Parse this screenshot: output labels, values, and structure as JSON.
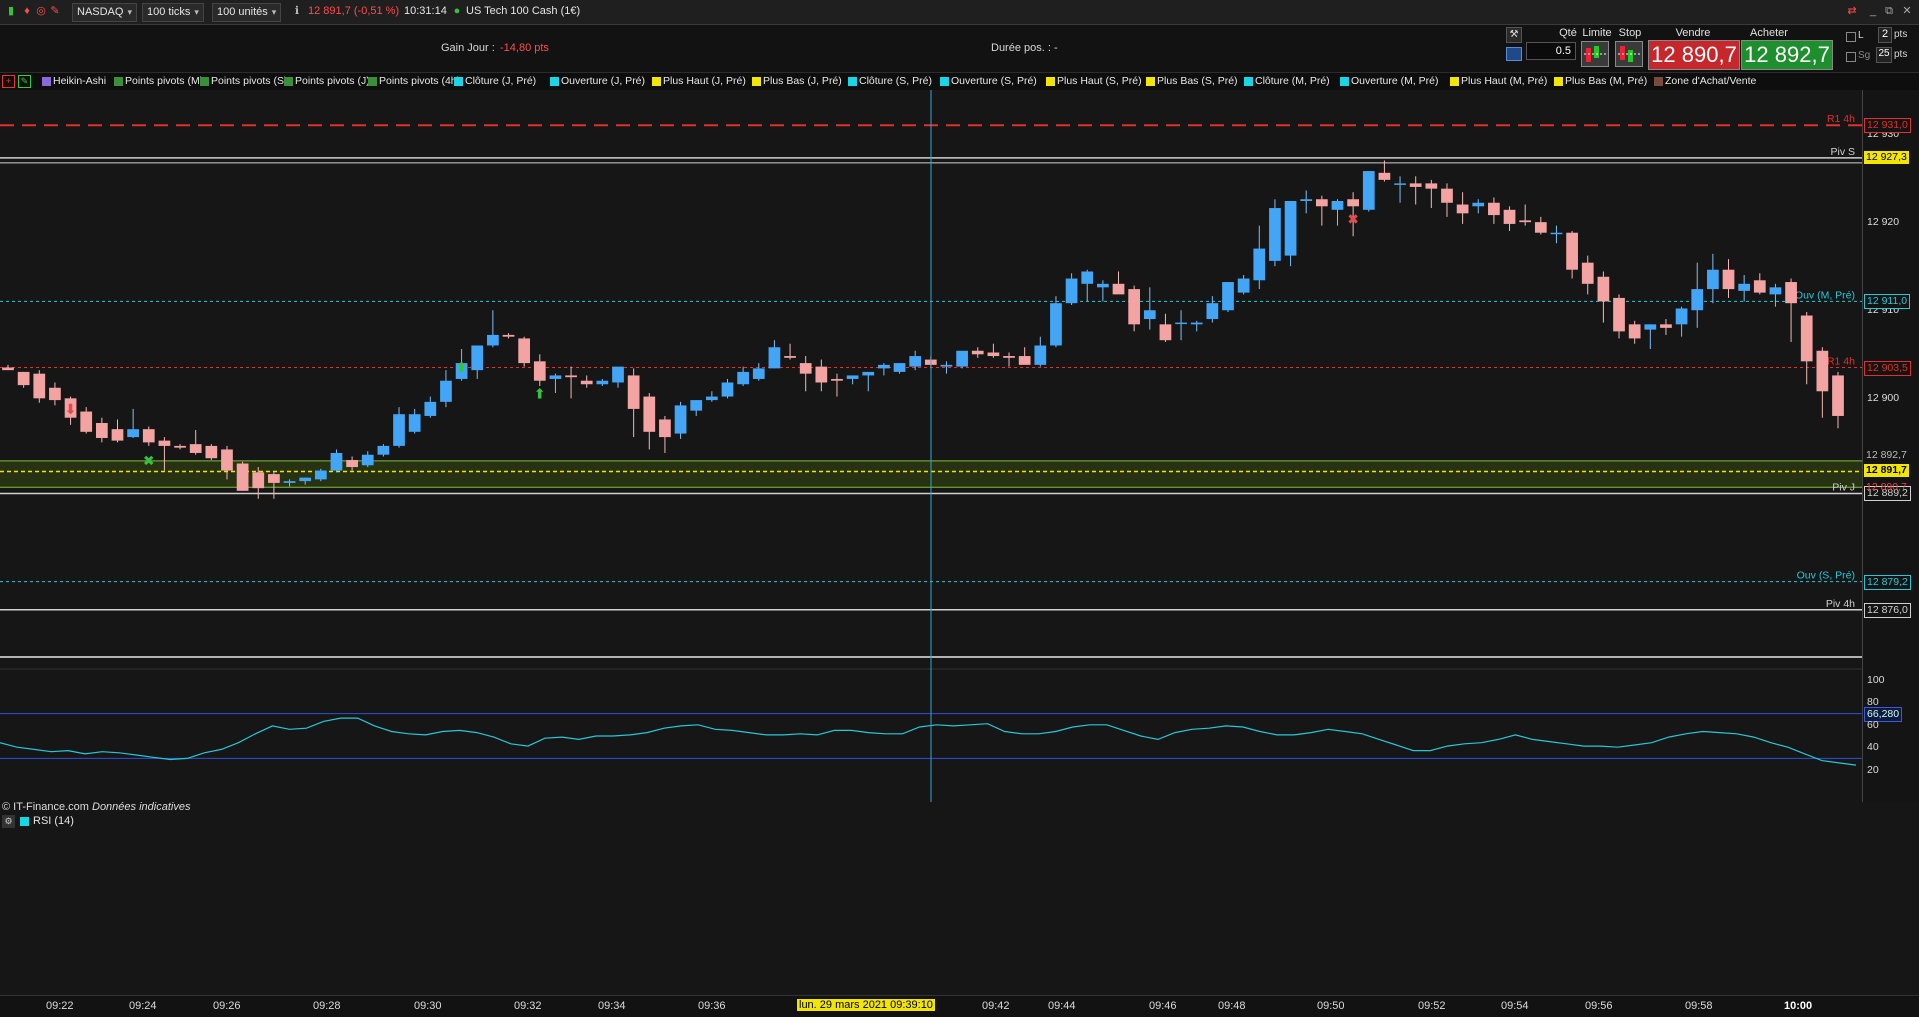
{
  "toolbar": {
    "market": "NASDAQ",
    "ticks": "100 ticks",
    "units": "100 unités",
    "price_change": "12 891,7 (-0,51 %)",
    "time": "10:31:14",
    "instrument": "US Tech 100 Cash (1€)"
  },
  "info": {
    "gain_label": "Gain Jour :",
    "gain_value": "-14,80 pts",
    "duree_label": "Durée pos. :",
    "duree_value": "-"
  },
  "order_panel": {
    "qty_label": "Qté",
    "qty_value": "0.5",
    "limit_label": "Limite",
    "stop_label": "Stop",
    "sell_label": "Vendre",
    "buy_label": "Acheter",
    "sell_price": "12 890,7",
    "buy_price": "12 892,7",
    "l_label": "L",
    "pts_value": "2",
    "pts_label": "pts",
    "sg_label": "Sg",
    "sg_value": "25",
    "sg_unit": "pts"
  },
  "indicators": [
    {
      "label": "Heikin-Ashi",
      "color": "#8a6ad8"
    },
    {
      "label": "Points pivots (M)",
      "color": "#3a8f3a"
    },
    {
      "label": "Points pivots (S)",
      "color": "#3a8f3a"
    },
    {
      "label": "Points pivots (J)",
      "color": "#3a8f3a"
    },
    {
      "label": "Points pivots (4h)",
      "color": "#3a8f3a"
    },
    {
      "label": "Clôture (J, Pré)",
      "color": "#19d6e6"
    },
    {
      "label": "Ouverture (J, Pré)",
      "color": "#19d6e6"
    },
    {
      "label": "Plus Haut (J, Pré)",
      "color": "#f2e600"
    },
    {
      "label": "Plus Bas (J, Pré)",
      "color": "#f2e600"
    },
    {
      "label": "Clôture (S, Pré)",
      "color": "#19d6e6"
    },
    {
      "label": "Ouverture (S, Pré)",
      "color": "#19d6e6"
    },
    {
      "label": "Plus Haut (S, Pré)",
      "color": "#f2e600"
    },
    {
      "label": "Plus Bas (S, Pré)",
      "color": "#f2e600"
    },
    {
      "label": "Clôture (M, Pré)",
      "color": "#19d6e6"
    },
    {
      "label": "Ouverture (M, Pré)",
      "color": "#19d6e6"
    },
    {
      "label": "Plus Haut (M, Pré)",
      "color": "#f2e600"
    },
    {
      "label": "Plus Bas (M, Pré)",
      "color": "#f2e600"
    },
    {
      "label": "Zone d'Achat/Vente",
      "color": "#7a4a3a"
    }
  ],
  "levels": [
    {
      "name": "R1 4h",
      "value": "12 931,0",
      "color": "#e0302a",
      "label": "R1 4h"
    },
    {
      "name": "Piv S",
      "value": "12 927,3",
      "color": "#d0d0d0",
      "label": "Piv S"
    },
    {
      "name": "Ouv (M, Pré)",
      "value": "12 911,0",
      "color": "#25c8d8",
      "label": "Ouv (M, Pré)"
    },
    {
      "name": "PR1 4h",
      "value": "12 903,5",
      "color": "#e0302a",
      "label": "PR1 4h"
    },
    {
      "name": "Piv J",
      "value": "12 889,2",
      "color": "#d0d0d0",
      "label": "Piv J"
    },
    {
      "name": "Ouv (S, Pré)",
      "value": "12 879,2",
      "color": "#25c8d8",
      "label": "Ouv (S, Pré)"
    },
    {
      "name": "Piv 4h",
      "value": "12 876,0",
      "color": "#d0d0d0",
      "label": "Piv 4h"
    }
  ],
  "price_axis": {
    "ticks": [
      "12 930",
      "12 920",
      "12 910",
      "12 900"
    ],
    "current_price": "12 891,7",
    "tag_high": "12 892,7",
    "tag_low": "12 890,7"
  },
  "footer": {
    "source": "© IT-Finance.com",
    "disclaimer": "Données indicatives"
  },
  "rsi": {
    "label": "RSI (14)",
    "ticks": [
      "100",
      "80",
      "60",
      "40",
      "20"
    ],
    "current": "66,280",
    "upper": 70,
    "lower": 30
  },
  "time_axis": {
    "labels": [
      "09:22",
      "09:24",
      "09:26",
      "09:28",
      "09:30",
      "09:32",
      "09:34",
      "09:36",
      "09:42",
      "09:44",
      "09:46",
      "09:48",
      "09:50",
      "09:52",
      "09:54",
      "09:56",
      "09:58",
      "10:00"
    ],
    "cursor_label": "lun. 29 mars 2021 09:39:10"
  },
  "chart_data": {
    "type": "candlestick",
    "y_range": [
      12872,
      12935
    ],
    "candles": [
      [
        12903.5,
        12903.8,
        12903.2,
        12903.2
      ],
      [
        12903.0,
        12903.0,
        12901.2,
        12901.5
      ],
      [
        12902.8,
        12903.2,
        12899.5,
        12900.0
      ],
      [
        12901.2,
        12901.8,
        12899.2,
        12899.8
      ],
      [
        12900.0,
        12900.2,
        12897.0,
        12897.8
      ],
      [
        12898.5,
        12899.0,
        12896.0,
        12896.2
      ],
      [
        12897.2,
        12897.8,
        12895.0,
        12895.5
      ],
      [
        12896.5,
        12897.6,
        12895.0,
        12895.2
      ],
      [
        12895.6,
        12898.8,
        12895.5,
        12896.5
      ],
      [
        12896.5,
        12896.8,
        12894.6,
        12895.0
      ],
      [
        12895.2,
        12895.6,
        12891.8,
        12894.6
      ],
      [
        12894.6,
        12894.8,
        12894.2,
        12894.4
      ],
      [
        12894.8,
        12896.4,
        12893.6,
        12893.8
      ],
      [
        12894.6,
        12894.8,
        12893.0,
        12893.2
      ],
      [
        12894.2,
        12894.6,
        12890.8,
        12891.8
      ],
      [
        12892.6,
        12892.8,
        12889.5,
        12889.5
      ],
      [
        12891.6,
        12892.2,
        12888.6,
        12889.8
      ],
      [
        12891.4,
        12891.6,
        12888.6,
        12890.4
      ],
      [
        12890.4,
        12890.8,
        12890.0,
        12890.6
      ],
      [
        12890.6,
        12891.0,
        12890.2,
        12891.0
      ],
      [
        12890.8,
        12892.0,
        12890.6,
        12891.8
      ],
      [
        12891.8,
        12894.2,
        12891.6,
        12893.8
      ],
      [
        12893.0,
        12893.4,
        12891.8,
        12892.2
      ],
      [
        12892.4,
        12894.0,
        12892.2,
        12893.6
      ],
      [
        12893.6,
        12894.8,
        12893.4,
        12894.6
      ],
      [
        12894.6,
        12899.0,
        12894.4,
        12898.2
      ],
      [
        12896.2,
        12898.8,
        12896.0,
        12898.2
      ],
      [
        12898.0,
        12900.2,
        12897.8,
        12899.6
      ],
      [
        12899.6,
        12903.2,
        12899.0,
        12902.0
      ],
      [
        12902.2,
        12905.6,
        12902.0,
        12904.0
      ],
      [
        12903.2,
        12906.0,
        12902.2,
        12906.0
      ],
      [
        12906.0,
        12910.0,
        12905.8,
        12907.2
      ],
      [
        12907.2,
        12907.4,
        12906.8,
        12907.0
      ],
      [
        12906.8,
        12907.0,
        12903.6,
        12904.0
      ],
      [
        12904.2,
        12905.0,
        12901.4,
        12902.0
      ],
      [
        12902.2,
        12902.8,
        12900.6,
        12902.6
      ],
      [
        12902.6,
        12903.6,
        12900.0,
        12902.4
      ],
      [
        12902.0,
        12902.6,
        12901.2,
        12901.6
      ],
      [
        12901.6,
        12902.2,
        12901.4,
        12902.0
      ],
      [
        12901.8,
        12902.4,
        12901.2,
        12903.6
      ],
      [
        12902.6,
        12903.4,
        12895.6,
        12898.8
      ],
      [
        12900.2,
        12900.6,
        12894.2,
        12896.2
      ],
      [
        12897.6,
        12898.0,
        12893.8,
        12895.6
      ],
      [
        12896.0,
        12899.6,
        12895.4,
        12899.2
      ],
      [
        12898.6,
        12899.6,
        12898.0,
        12899.8
      ],
      [
        12899.8,
        12900.8,
        12899.6,
        12900.2
      ],
      [
        12900.2,
        12902.2,
        12900.0,
        12901.8
      ],
      [
        12901.6,
        12903.6,
        12901.4,
        12903.0
      ],
      [
        12902.2,
        12904.0,
        12902.0,
        12903.4
      ],
      [
        12903.4,
        12906.6,
        12903.4,
        12905.8
      ],
      [
        12904.8,
        12906.2,
        12904.4,
        12904.6
      ],
      [
        12904.0,
        12904.8,
        12900.8,
        12902.8
      ],
      [
        12903.6,
        12904.4,
        12900.8,
        12901.8
      ],
      [
        12902.2,
        12902.8,
        12900.2,
        12902.0
      ],
      [
        12902.2,
        12902.6,
        12901.6,
        12902.6
      ],
      [
        12902.6,
        12902.8,
        12900.8,
        12903.0
      ],
      [
        12903.4,
        12904.0,
        12902.6,
        12903.8
      ],
      [
        12903.0,
        12904.0,
        12902.8,
        12904.0
      ],
      [
        12903.6,
        12905.4,
        12903.2,
        12904.8
      ],
      [
        12904.4,
        12904.8,
        12903.4,
        12903.8
      ],
      [
        12903.6,
        12904.2,
        12902.8,
        12903.8
      ],
      [
        12903.6,
        12904.6,
        12903.4,
        12905.4
      ],
      [
        12905.4,
        12905.8,
        12904.6,
        12905.0
      ],
      [
        12905.2,
        12906.2,
        12904.6,
        12904.8
      ],
      [
        12904.8,
        12905.2,
        12903.6,
        12904.6
      ],
      [
        12904.8,
        12905.8,
        12904.6,
        12903.8
      ],
      [
        12903.8,
        12907.0,
        12903.6,
        12906.0
      ],
      [
        12906.0,
        12911.6,
        12905.8,
        12910.8
      ],
      [
        12910.8,
        12914.2,
        12910.6,
        12913.6
      ],
      [
        12913.0,
        12914.6,
        12911.0,
        12914.4
      ],
      [
        12912.6,
        12913.4,
        12911.0,
        12913.0
      ],
      [
        12913.0,
        12914.4,
        12912.4,
        12911.8
      ],
      [
        12912.4,
        12912.8,
        12907.6,
        12908.4
      ],
      [
        12909.0,
        12912.6,
        12907.8,
        12910.0
      ],
      [
        12908.4,
        12909.6,
        12906.4,
        12906.6
      ],
      [
        12908.6,
        12910.0,
        12906.6,
        12908.6
      ],
      [
        12908.4,
        12908.8,
        12907.6,
        12908.6
      ],
      [
        12909.0,
        12911.6,
        12908.6,
        12910.8
      ],
      [
        12910.0,
        12913.0,
        12909.8,
        12913.2
      ],
      [
        12912.0,
        12914.0,
        12911.8,
        12913.6
      ],
      [
        12913.4,
        12919.6,
        12912.4,
        12917.0
      ],
      [
        12915.6,
        12922.6,
        12915.0,
        12921.6
      ],
      [
        12916.2,
        12922.4,
        12915.0,
        12922.4
      ],
      [
        12922.4,
        12923.6,
        12921.0,
        12922.6
      ],
      [
        12922.6,
        12923.0,
        12919.6,
        12921.8
      ],
      [
        12921.4,
        12922.6,
        12919.6,
        12922.4
      ],
      [
        12922.6,
        12923.4,
        12918.4,
        12921.8
      ],
      [
        12921.4,
        12925.0,
        12921.2,
        12925.8
      ],
      [
        12925.6,
        12927.0,
        12924.6,
        12924.8
      ],
      [
        12924.4,
        12925.2,
        12922.2,
        12924.4
      ],
      [
        12924.4,
        12925.2,
        12922.0,
        12924.0
      ],
      [
        12924.4,
        12924.8,
        12921.6,
        12923.8
      ],
      [
        12923.8,
        12924.4,
        12920.6,
        12922.2
      ],
      [
        12922.0,
        12923.4,
        12919.8,
        12921.0
      ],
      [
        12921.8,
        12922.6,
        12921.0,
        12922.2
      ],
      [
        12922.2,
        12922.8,
        12919.8,
        12920.8
      ],
      [
        12921.4,
        12921.8,
        12919.0,
        12919.8
      ],
      [
        12920.2,
        12922.0,
        12919.6,
        12920.0
      ],
      [
        12920.0,
        12920.6,
        12918.6,
        12918.8
      ],
      [
        12918.8,
        12919.6,
        12917.6,
        12918.8
      ],
      [
        12918.8,
        12919.0,
        12913.6,
        12914.6
      ],
      [
        12915.4,
        12916.2,
        12911.8,
        12913.0
      ],
      [
        12913.8,
        12914.4,
        12908.6,
        12911.0
      ],
      [
        12911.4,
        12911.8,
        12906.8,
        12907.6
      ],
      [
        12908.4,
        12908.8,
        12906.2,
        12906.8
      ],
      [
        12907.8,
        12908.4,
        12905.6,
        12908.4
      ],
      [
        12908.4,
        12909.0,
        12907.2,
        12908.0
      ],
      [
        12908.4,
        12910.4,
        12907.0,
        12910.2
      ],
      [
        12910.0,
        12915.4,
        12908.0,
        12912.4
      ],
      [
        12912.4,
        12916.4,
        12910.8,
        12914.6
      ],
      [
        12914.6,
        12915.8,
        12911.4,
        12912.4
      ],
      [
        12912.2,
        12914.0,
        12911.0,
        12913.0
      ],
      [
        12913.4,
        12914.2,
        12911.8,
        12912.0
      ],
      [
        12911.8,
        12913.0,
        12910.4,
        12912.6
      ],
      [
        12913.2,
        12913.6,
        12906.4,
        12910.8
      ],
      [
        12909.4,
        12909.8,
        12901.6,
        12904.2
      ],
      [
        12905.4,
        12905.8,
        12897.8,
        12900.8
      ],
      [
        12902.6,
        12903.0,
        12896.6,
        12898.0
      ]
    ],
    "rsi_values": [
      44,
      40,
      38,
      36,
      37,
      34,
      36,
      35,
      33,
      31,
      29,
      30,
      35,
      38,
      44,
      52,
      59,
      56,
      57,
      63,
      66,
      66,
      59,
      54,
      52,
      51,
      54,
      55,
      53,
      49,
      43,
      41,
      48,
      49,
      47,
      50,
      50,
      51,
      53,
      57,
      59,
      60,
      56,
      55,
      53,
      51,
      51,
      52,
      51,
      55,
      55,
      53,
      52,
      52,
      58,
      60,
      59,
      60,
      61,
      54,
      52,
      52,
      54,
      58,
      60,
      60,
      55,
      50,
      47,
      53,
      56,
      57,
      59,
      58,
      54,
      51,
      51,
      53,
      56,
      54,
      52,
      47,
      42,
      37,
      37,
      41,
      43,
      44,
      47,
      51,
      47,
      45,
      43,
      41,
      41,
      40,
      42,
      44,
      49,
      52,
      54,
      53,
      52,
      49,
      44,
      40,
      34,
      28,
      26,
      24
    ],
    "rsi_ylim": [
      0,
      100
    ]
  }
}
